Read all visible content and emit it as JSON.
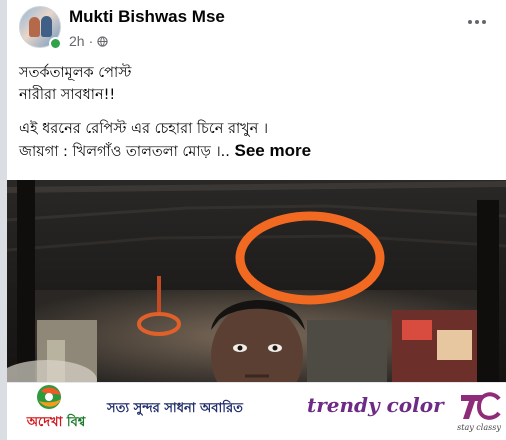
{
  "post": {
    "author": "Mukti Bishwas Mse",
    "time": "2h",
    "separator": "·",
    "lines": [
      "সতর্কতামূলক পোস্ট",
      "নারীরা সাবধান!!",
      "এই ধরনের রেপিস্ট এর চেহারা চিনে রাখুন ।",
      "জায়গা : খিলগাঁও তালতলা মোড় ।.."
    ],
    "see_more": "See more"
  },
  "icons": {
    "avatar": "profile-avatar",
    "online": "online-status-dot",
    "privacy": "globe-icon",
    "more": "more-options-icon"
  },
  "banner": {
    "brand_left_part1": "অদেখা ",
    "brand_left_part2": "বিশ্ব",
    "slogan": "সত্য সুন্দর সাধনা অবারিত",
    "brand_middle": "trendy color",
    "brand_right_tagline": "stay classy"
  },
  "colors": {
    "text_primary": "#050505",
    "text_secondary": "#65676b",
    "online_green": "#31a24c",
    "handle_orange": "#f26a22",
    "trendy_purple": "#6d2b86"
  }
}
